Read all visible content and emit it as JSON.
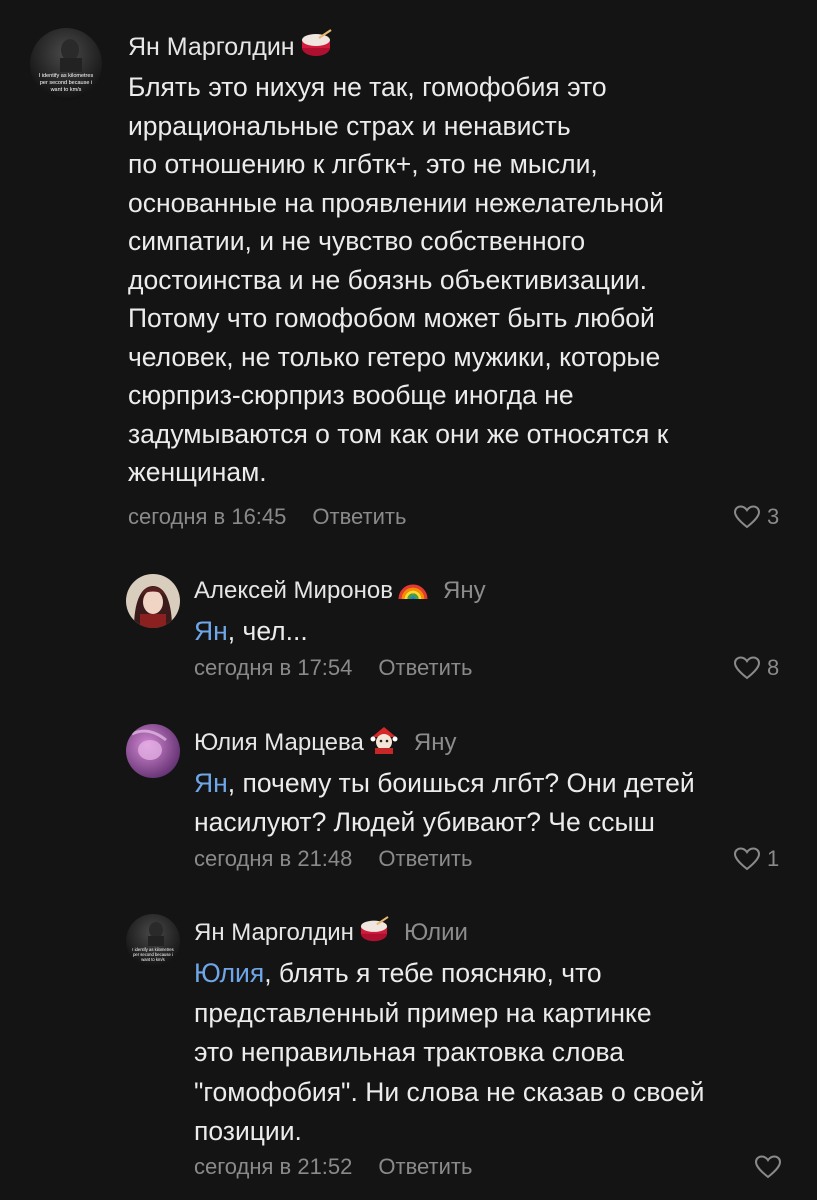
{
  "colors": {
    "background": "#141414",
    "text": "#ececec",
    "muted": "#8a8a8a",
    "mention": "#6fa6e8"
  },
  "comments": [
    {
      "author": "Ян Марголдин",
      "avatar_text": [
        "I identify as kilometres",
        "per second because i",
        "want to km/s"
      ],
      "author_emoji": "drum-icon",
      "reply_to": "",
      "mention": "",
      "text_lines": [
        "Блять это нихуя не так, гомофобия это",
        "иррациональные страх и ненависть",
        "по отношению к лгбтк+, это не мысли,",
        "основанные на проявлении нежелательной",
        "симпатии, и не чувство собственного",
        "достоинства и не боязнь объективизации.",
        "Потому что гомофобом может быть любой",
        "человек, не только гетеро мужики, которые",
        "сюрприз-сюрприз вообще иногда не",
        "задумываются о том как они же относятся к",
        "женщинам."
      ],
      "timestamp": "сегодня в 16:45",
      "reply_label": "Ответить",
      "likes": "3"
    },
    {
      "author": "Алексей Миронов",
      "author_emoji": "rainbow-icon",
      "reply_to": "Яну",
      "mention": "Ян",
      "text_lines": [
        ", чел..."
      ],
      "timestamp": "сегодня в 17:54",
      "reply_label": "Ответить",
      "likes": "8"
    },
    {
      "author": "Юлия Марцева",
      "author_emoji": "character-emoji-icon",
      "reply_to": "Яну",
      "mention": "Ян",
      "text_lines": [
        ", почему ты боишься лгбт? Они детей",
        "насилуют? Людей убивают? Че ссыш"
      ],
      "timestamp": "сегодня в 21:48",
      "reply_label": "Ответить",
      "likes": "1"
    },
    {
      "author": "Ян Марголдин",
      "avatar_text": [
        "I identify as kilometres",
        "per second because i",
        "want to km/s"
      ],
      "author_emoji": "drum-icon",
      "reply_to": "Юлии",
      "mention": "Юлия",
      "text_lines": [
        ", блять я тебе поясняю, что",
        "представленный пример на картинке",
        "это неправильная трактовка слова",
        "\"гомофобия\". Ни слова не сказав о своей",
        "позиции."
      ],
      "timestamp": "сегодня в 21:52",
      "reply_label": "Ответить",
      "likes": ""
    }
  ]
}
